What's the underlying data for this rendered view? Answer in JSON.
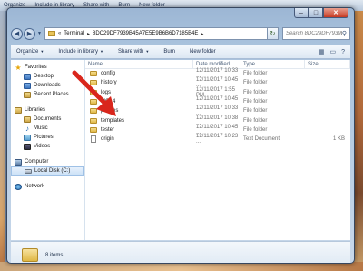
{
  "background_window": {
    "items": [
      "Organize",
      "Include in library",
      "Share with",
      "Burn",
      "New folder"
    ]
  },
  "titlebar": {
    "minimize": "–",
    "maximize": "□",
    "close": "✕"
  },
  "navigation": {
    "back": "◀",
    "forward": "▶",
    "breadcrumb": [
      "Terminal",
      "8DC29DF7939B45A7E5E9B6B6D7185B4E"
    ],
    "refresh": "↻",
    "search_placeholder": "Search 8DC29DF7939B45A7E5E9B6B6D7..."
  },
  "toolbar": {
    "organize": "Organize",
    "include_in_library": "Include in library",
    "share_with": "Share with",
    "burn": "Burn",
    "new_folder": "New folder",
    "view_icon": "view-options-icon",
    "help_icon": "help-icon"
  },
  "sidebar": {
    "favorites": {
      "label": "Favorites",
      "items": [
        "Desktop",
        "Downloads",
        "Recent Places"
      ]
    },
    "libraries": {
      "label": "Libraries",
      "items": [
        "Documents",
        "Music",
        "Pictures",
        "Videos"
      ]
    },
    "computer": {
      "label": "Computer",
      "items": [
        "Local Disk (C:)"
      ]
    },
    "network": {
      "label": "Network"
    }
  },
  "columns": [
    "Name",
    "Date modified",
    "Type",
    "Size"
  ],
  "files": [
    {
      "name": "config",
      "date": "12/11/2017 10:33 ...",
      "type": "File folder",
      "size": "",
      "kind": "folder"
    },
    {
      "name": "history",
      "date": "12/11/2017 10:45 ...",
      "type": "File folder",
      "size": "",
      "kind": "folder"
    },
    {
      "name": "logs",
      "date": "12/11/2017 1:55 PM",
      "type": "File folder",
      "size": "",
      "kind": "folder"
    },
    {
      "name": "MQL4",
      "date": "12/11/2017 10:45 ...",
      "type": "File folder",
      "size": "",
      "kind": "folder"
    },
    {
      "name": "profiles",
      "date": "12/11/2017 10:33 ...",
      "type": "File folder",
      "size": "",
      "kind": "folder"
    },
    {
      "name": "templates",
      "date": "12/11/2017 10:38 ...",
      "type": "File folder",
      "size": "",
      "kind": "folder"
    },
    {
      "name": "tester",
      "date": "12/11/2017 10:45 ...",
      "type": "File folder",
      "size": "",
      "kind": "folder"
    },
    {
      "name": "origin",
      "date": "12/11/2017 10:23 ...",
      "type": "Text Document",
      "size": "1 KB",
      "kind": "document"
    }
  ],
  "status": {
    "item_count": "8 items"
  },
  "colors": {
    "arrow": "#d9261c",
    "folder": "#e0b948"
  }
}
